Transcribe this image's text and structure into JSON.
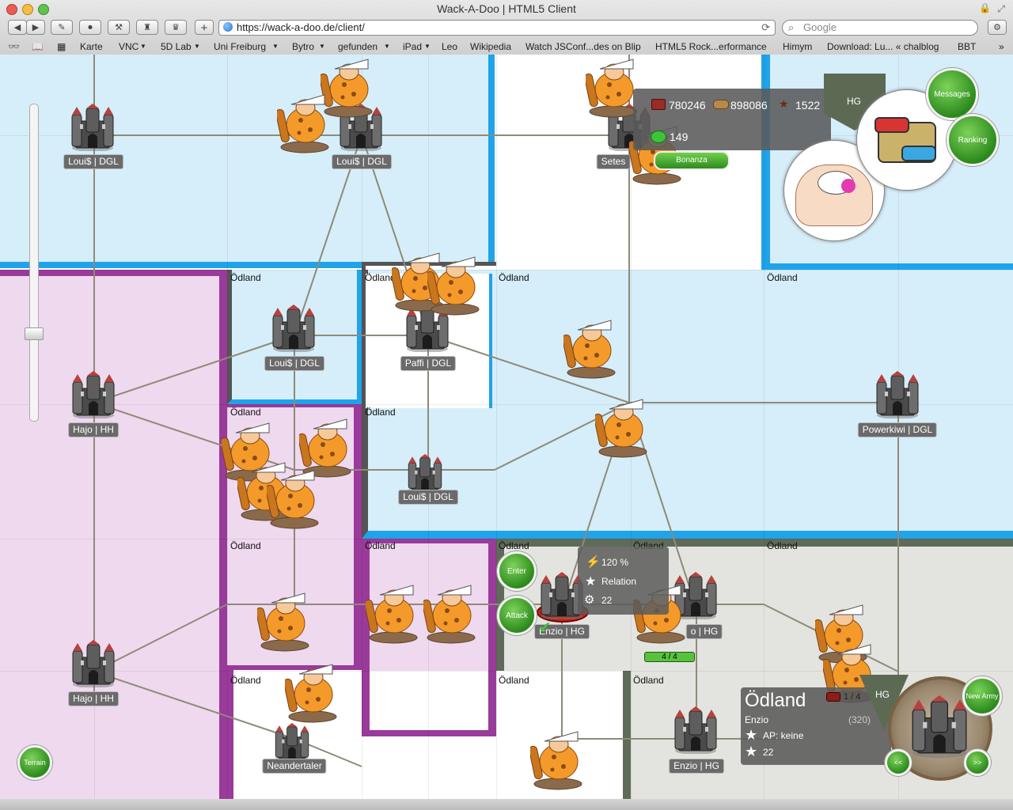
{
  "window": {
    "title": "Wack-A-Doo | HTML5 Client"
  },
  "toolbar": {
    "url": "https://wack-a-doo.de/client/",
    "search_placeholder": "Google"
  },
  "bookmarks": [
    "Karte",
    "VNC",
    "5D Lab",
    "Uni Freiburg",
    "Bytro",
    "gefunden",
    "iPad",
    "Leo",
    "Wikipedia",
    "Watch JSConf...des on Blip",
    "HTML5 Rock...erformance",
    "Himym",
    "Download: Lu... « chalblog",
    "BBT"
  ],
  "regions": {
    "labels": [
      "Ödland",
      "Ödland",
      "Ödland",
      "Ödland",
      "Ödland",
      "Ödland",
      "Ödland",
      "Ödland",
      "Ödland",
      "Ödland",
      "Ödland",
      "Ödland",
      "Ödland",
      "Ödland"
    ],
    "colors": {
      "dgl": "#d5eefa",
      "dgl_border": "#1fa3ea",
      "hh": "#efd9ef",
      "hh_border": "#9a3a9a",
      "hg": "#e3e4df",
      "hg_border": "#5f6b58"
    }
  },
  "forts": [
    {
      "label": "Loui$ | DGL"
    },
    {
      "label": "Loui$ | DGL"
    },
    {
      "label": "Setes"
    },
    {
      "label": "Loui$ | DGL"
    },
    {
      "label": "Paffi | DGL"
    },
    {
      "label": "Hajo | HH"
    },
    {
      "label": "Powerkiwi | DGL"
    },
    {
      "label": "Loui$ | DGL"
    },
    {
      "label": "Enzio | HG"
    },
    {
      "label": "o | HG"
    },
    {
      "label": "Hajo | HH"
    },
    {
      "label": "Neandertaler"
    },
    {
      "label": "Enzio | HG"
    }
  ],
  "resources": {
    "stone": "780246",
    "wood": "898086",
    "fur": "1522",
    "frogs": "149",
    "bonanza_label": "Bonanza"
  },
  "hud": {
    "messages_label": "Messages",
    "ranking_label": "Ranking",
    "alliance_tag": "HG",
    "terrain_label": "Terrain"
  },
  "region_popup": {
    "enter_label": "Enter",
    "attack_label": "Attack",
    "speed": "120 %",
    "relation": "Relation",
    "level": "22"
  },
  "army_hp": "4 / 4",
  "settlement": {
    "name": "Ödland",
    "owner": "Enzio",
    "points": "(320)",
    "ap": "AP: keine",
    "level": "22",
    "army_count": "1 / 4",
    "tag": "HG",
    "new_army_label": "New Army",
    "prev_label": "<<",
    "next_label": ">>"
  },
  "zoom": {
    "level": 0.65
  }
}
